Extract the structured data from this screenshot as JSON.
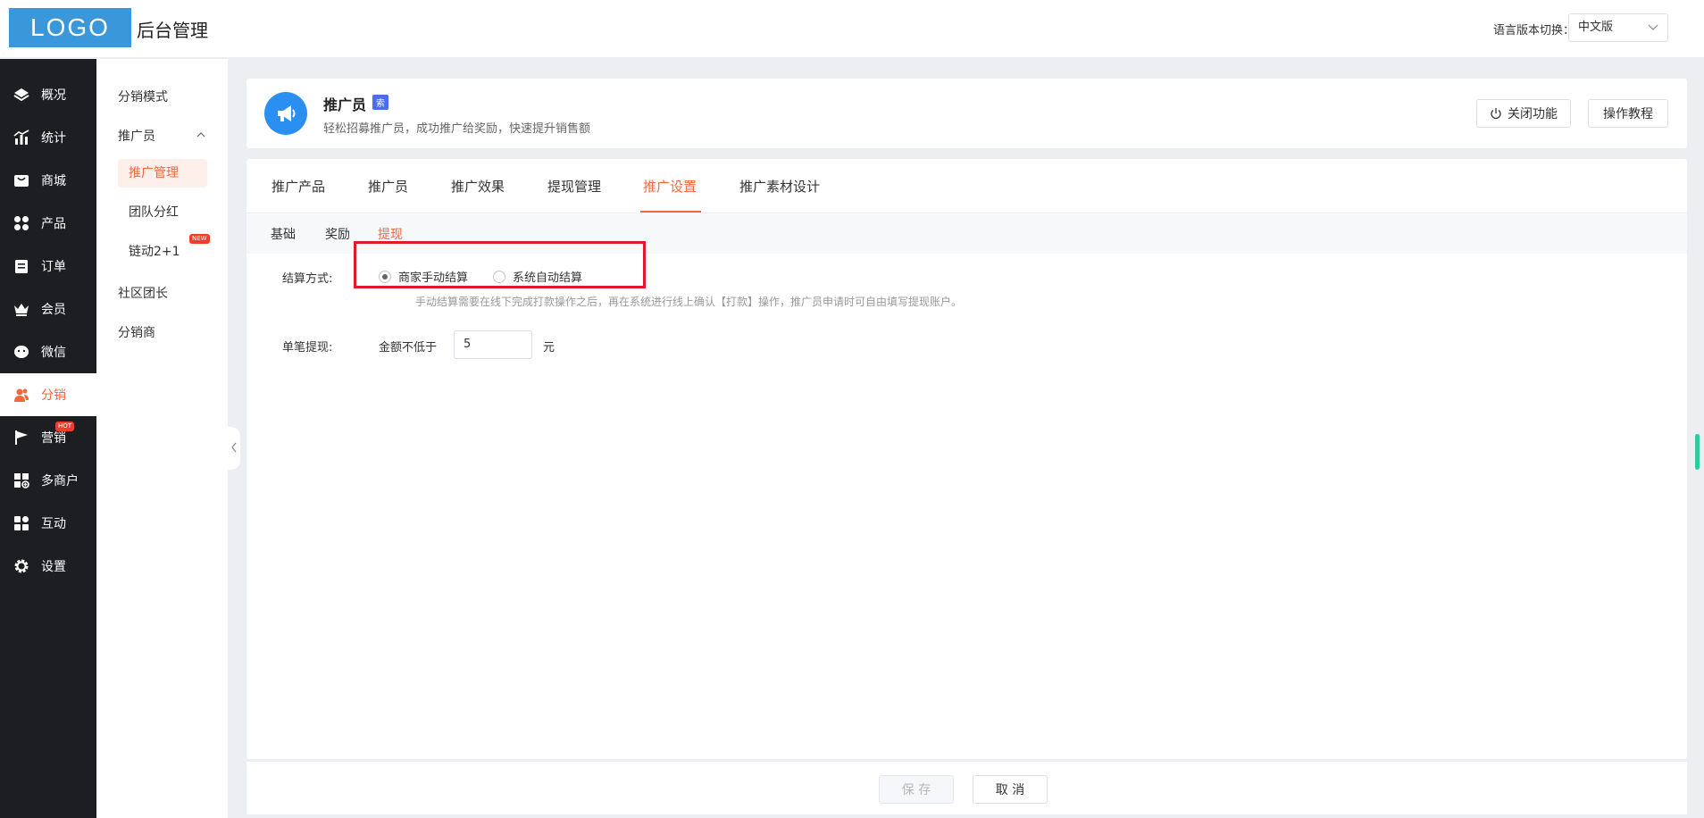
{
  "header": {
    "logo": "LOGO",
    "title": "后台管理",
    "lang_label": "语言版本切换：",
    "lang_value": "中文版"
  },
  "sidebar": {
    "items": [
      {
        "label": "概况",
        "icon": "layers-icon"
      },
      {
        "label": "统计",
        "icon": "chart-icon"
      },
      {
        "label": "商城",
        "icon": "shop-icon"
      },
      {
        "label": "产品",
        "icon": "grid-icon"
      },
      {
        "label": "订单",
        "icon": "order-icon"
      },
      {
        "label": "会员",
        "icon": "crown-icon"
      },
      {
        "label": "微信",
        "icon": "wechat-icon"
      },
      {
        "label": "分销",
        "icon": "users-icon"
      },
      {
        "label": "营销",
        "icon": "flag-icon",
        "badge": "HOT"
      },
      {
        "label": "多商户",
        "icon": "multi-store-icon"
      },
      {
        "label": "互动",
        "icon": "interact-icon"
      },
      {
        "label": "设置",
        "icon": "gear-icon"
      }
    ],
    "active": "分销",
    "active_color": "#f2683d"
  },
  "submenu": {
    "distribution_mode": "分销模式",
    "promoter": "推广员",
    "promoter_manage": "推广管理",
    "team_bonus": "团队分红",
    "chain": "链动2+1",
    "chain_badge": "NEW",
    "community_leader": "社区团长",
    "distributor": "分销商"
  },
  "feature": {
    "title": "推广员",
    "badge": "索",
    "description": "轻松招募推广员，成功推广给奖励，快速提升销售额",
    "close_button": "关闭功能",
    "tutorial_button": "操作教程"
  },
  "tabs": {
    "items": [
      "推广产品",
      "推广员",
      "推广效果",
      "提现管理",
      "推广设置",
      "推广素材设计"
    ],
    "active": "推广设置"
  },
  "subtabs": {
    "items": [
      "基础",
      "奖励",
      "提现"
    ],
    "active": "提现"
  },
  "form": {
    "settlement_label": "结算方式:",
    "option_manual": "商家手动结算",
    "option_auto": "系统自动结算",
    "selected": "商家手动结算",
    "hint": "手动结算需要在线下完成打款操作之后，再在系统进行线上确认【打款】操作，推广员申请时可自由填写提现账户。",
    "single_label": "单笔提现:",
    "min_label": "金额不低于",
    "min_value": "5",
    "unit": "元"
  },
  "footer": {
    "save": "保 存",
    "cancel": "取 消"
  }
}
